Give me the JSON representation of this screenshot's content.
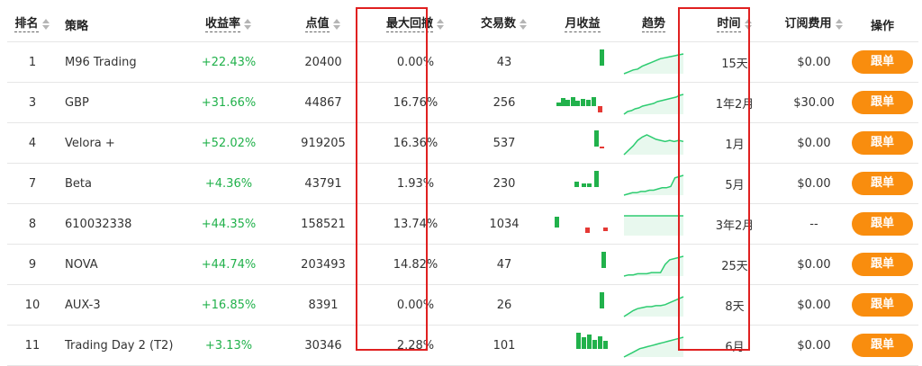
{
  "headers": {
    "rank": "排名",
    "strategy": "策略",
    "return": "收益率",
    "pips": "点值",
    "drawdown": "最大回撤",
    "trades": "交易数",
    "monthly": "月收益",
    "trend": "趋势",
    "time": "时间",
    "fee": "订阅费用",
    "action": "操作"
  },
  "rows": [
    {
      "rank": "1",
      "name": "M96 Trading",
      "ret": "+22.43%",
      "pips": "20400",
      "dd": "0.00%",
      "trades": "43",
      "time": "15天",
      "fee": "$0.00",
      "action": "跟单",
      "bars": [
        {
          "x": 50,
          "h": 18,
          "c": "g"
        }
      ],
      "trend": [
        0,
        2,
        4,
        5,
        8,
        10,
        12,
        14,
        16,
        17,
        18,
        19,
        20,
        21
      ]
    },
    {
      "rank": "3",
      "name": "GBP",
      "ret": "+31.66%",
      "pips": "44867",
      "dd": "16.76%",
      "trades": "256",
      "time": "1年2月",
      "fee": "$30.00",
      "action": "跟单",
      "bars": [
        {
          "x": 2,
          "h": 4,
          "c": "g"
        },
        {
          "x": 7,
          "h": 9,
          "c": "g"
        },
        {
          "x": 12,
          "h": 7,
          "c": "g"
        },
        {
          "x": 18,
          "h": 10,
          "c": "g"
        },
        {
          "x": 23,
          "h": 6,
          "c": "g"
        },
        {
          "x": 29,
          "h": 8,
          "c": "g"
        },
        {
          "x": 35,
          "h": 7,
          "c": "g"
        },
        {
          "x": 41,
          "h": 10,
          "c": "g"
        },
        {
          "x": 48,
          "h": -7,
          "c": "r"
        }
      ],
      "trend": [
        0,
        3,
        4,
        6,
        7,
        9,
        10,
        11,
        12,
        14,
        15,
        16,
        17,
        18,
        19,
        21,
        22
      ]
    },
    {
      "rank": "4",
      "name": "Velora +",
      "ret": "+52.02%",
      "pips": "919205",
      "dd": "16.36%",
      "trades": "537",
      "time": "1月",
      "fee": "$0.00",
      "action": "跟单",
      "bars": [
        {
          "x": 44,
          "h": 18,
          "c": "g"
        },
        {
          "x": 50,
          "h": -2,
          "c": "r"
        }
      ],
      "trend": [
        0,
        4,
        8,
        13,
        16,
        18,
        16,
        14,
        13,
        12,
        13,
        12,
        13,
        12
      ]
    },
    {
      "rank": "7",
      "name": "Beta",
      "ret": "+4.36%",
      "pips": "43791",
      "dd": "1.93%",
      "trades": "230",
      "time": "5月",
      "fee": "$0.00",
      "action": "跟单",
      "bars": [
        {
          "x": 22,
          "h": 6,
          "c": "g"
        },
        {
          "x": 30,
          "h": 4,
          "c": "g"
        },
        {
          "x": 36,
          "h": 4,
          "c": "g"
        },
        {
          "x": 44,
          "h": 18,
          "c": "g"
        }
      ],
      "trend": [
        0,
        1,
        2,
        2,
        3,
        3,
        4,
        4,
        5,
        6,
        6,
        7,
        14,
        15,
        16
      ]
    },
    {
      "rank": "8",
      "name": "610032338",
      "ret": "+44.35%",
      "pips": "158521",
      "dd": "13.74%",
      "trades": "1034",
      "time": "3年2月",
      "fee": "--",
      "action": "跟单",
      "bars": [
        {
          "x": 0,
          "h": 12,
          "c": "g"
        },
        {
          "x": 34,
          "h": -6,
          "c": "r"
        },
        {
          "x": 54,
          "h": -4,
          "c": "r"
        }
      ],
      "trend": [
        18,
        18,
        18,
        18,
        18,
        18,
        18,
        18,
        18,
        18,
        18,
        18,
        18,
        18,
        18
      ]
    },
    {
      "rank": "9",
      "name": "NOVA",
      "ret": "+44.74%",
      "pips": "203493",
      "dd": "14.82%",
      "trades": "47",
      "time": "25天",
      "fee": "$0.00",
      "action": "跟单",
      "bars": [
        {
          "x": 52,
          "h": 18,
          "c": "g"
        }
      ],
      "trend": [
        0,
        1,
        1,
        2,
        2,
        2,
        3,
        3,
        3,
        10,
        14,
        15,
        16,
        17
      ]
    },
    {
      "rank": "10",
      "name": "AUX-3",
      "ret": "+16.85%",
      "pips": "8391",
      "dd": "0.00%",
      "trades": "26",
      "time": "8天",
      "fee": "$0.00",
      "action": "跟单",
      "bars": [
        {
          "x": 50,
          "h": 18,
          "c": "g"
        }
      ],
      "trend": [
        0,
        3,
        6,
        8,
        9,
        10,
        10,
        11,
        11,
        12,
        14,
        16,
        18,
        20
      ]
    },
    {
      "rank": "11",
      "name": "Trading Day 2 (T2)",
      "ret": "+3.13%",
      "pips": "30346",
      "dd": "2.28%",
      "trades": "101",
      "time": "6月",
      "fee": "$0.00",
      "action": "跟单",
      "bars": [
        {
          "x": 24,
          "h": 18,
          "c": "g"
        },
        {
          "x": 30,
          "h": 13,
          "c": "g"
        },
        {
          "x": 36,
          "h": 16,
          "c": "g"
        },
        {
          "x": 42,
          "h": 10,
          "c": "g"
        },
        {
          "x": 48,
          "h": 14,
          "c": "g"
        },
        {
          "x": 54,
          "h": 9,
          "c": "g"
        }
      ],
      "trend": [
        0,
        2,
        4,
        6,
        8,
        9,
        10,
        11,
        12,
        13,
        14,
        15,
        16,
        17,
        18,
        19
      ]
    }
  ],
  "colors": {
    "positive": "#21b14b",
    "negative": "#e53935",
    "button": "#f98d0e",
    "highlight": "#e02020",
    "trendline": "#2ecc71"
  }
}
